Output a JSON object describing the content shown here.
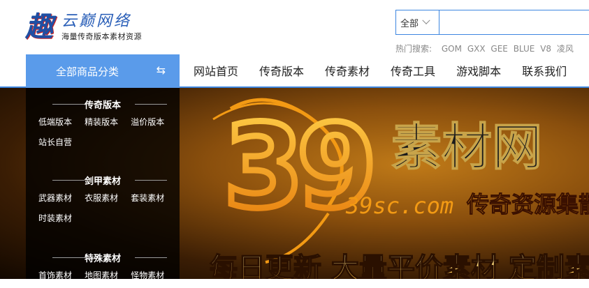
{
  "logo": {
    "mark": "趣",
    "title": "云巅网络",
    "subtitle": "海量传奇版本素材资源"
  },
  "search": {
    "scope": "全部",
    "value": "",
    "placeholder": ""
  },
  "hot_search": {
    "label": "热门搜索:",
    "keywords": [
      "GOM",
      "GXX",
      "GEE",
      "BLUE",
      "V8",
      "凌风"
    ]
  },
  "nav": {
    "category_button": "全部商品分类",
    "items": [
      "网站首页",
      "传奇版本",
      "传奇素材",
      "传奇工具",
      "游戏脚本",
      "联系我们"
    ]
  },
  "category_panel": {
    "groups": [
      {
        "title": "传奇版本",
        "links": [
          "低端版本",
          "精装版本",
          "溢价版本",
          "站长自营"
        ]
      },
      {
        "title": "剑甲素材",
        "links": [
          "武器素材",
          "衣服素材",
          "套装素材",
          "时装素材"
        ]
      },
      {
        "title": "特殊素材",
        "links": [
          "首饰素材",
          "地图素材",
          "怪物素材"
        ]
      }
    ]
  },
  "banner": {
    "number": "39",
    "title": "素材网",
    "domain": "39sc.com",
    "slogan": "传奇资源集散",
    "tagline": "每日更新 大量平价素材 定制素"
  },
  "colors": {
    "accent": "#3d86e0",
    "category_button": "#5a9bea",
    "banner_orange": "#f5a21c"
  }
}
